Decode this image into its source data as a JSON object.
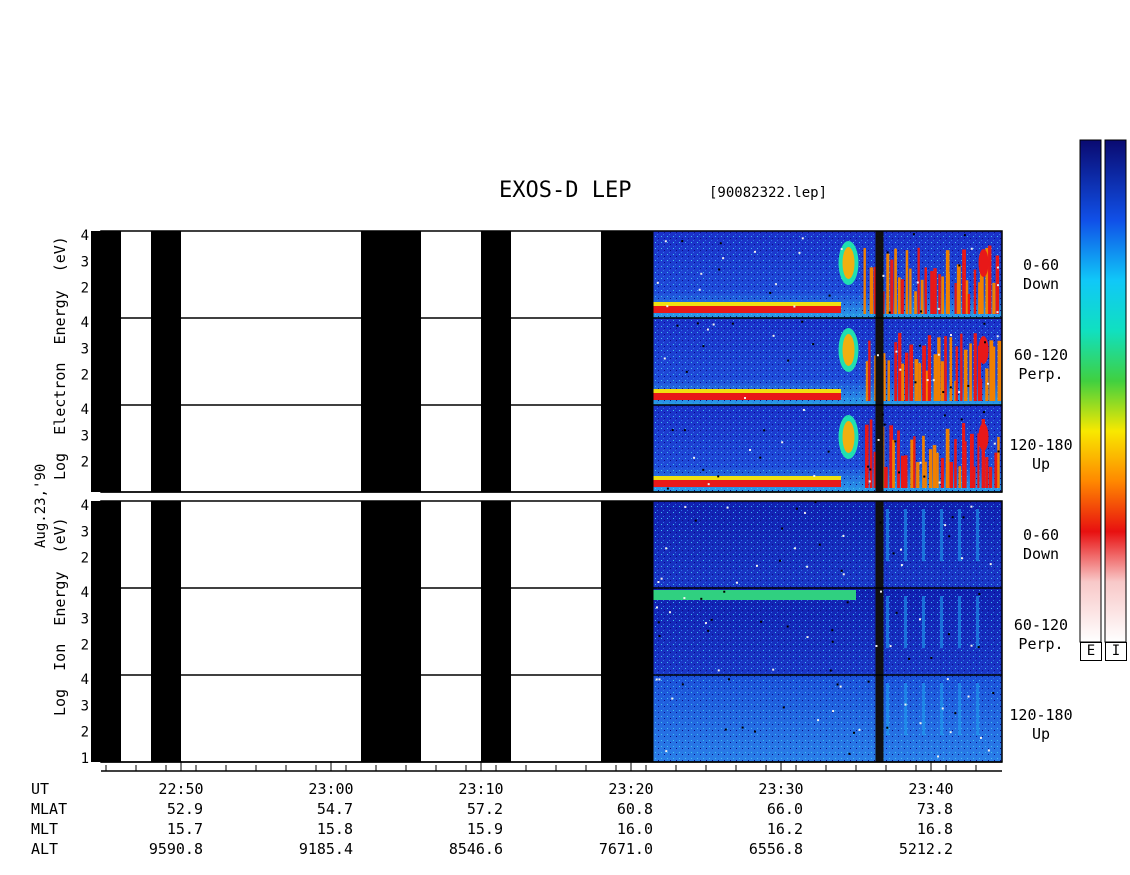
{
  "title": "EXOS-D LEP",
  "file_label": "[90082322.lep]",
  "date_label": "Aug.23,'90",
  "electron_ylabel": [
    "Log",
    "Electron",
    "Energy",
    "(eV)"
  ],
  "ion_ylabel": [
    "Log",
    "Ion",
    "Energy",
    "(eV)"
  ],
  "channels": [
    {
      "range": "0-60",
      "dir": "Down"
    },
    {
      "range": "60-120",
      "dir": "Perp."
    },
    {
      "range": "120-180",
      "dir": "Up"
    }
  ],
  "colorbar_labels": [
    "E",
    "I"
  ],
  "chart_data": {
    "type": "heatmap",
    "title": "EXOS-D LEP",
    "panels": [
      "Electron 0-60 Down",
      "Electron 60-120 Perp.",
      "Electron 120-180 Up",
      "Ion 0-60 Down",
      "Ion 60-120 Perp.",
      "Ion 120-180 Up"
    ],
    "y_ticks": [
      "4",
      "3",
      "2"
    ],
    "y_ticks_bottom": [
      "4",
      "3",
      "2",
      "1"
    ],
    "xlim_ut": [
      "22:44",
      "23:45"
    ],
    "x_ticks": [
      "22:50",
      "23:00",
      "23:10",
      "23:20",
      "23:30",
      "23:40"
    ],
    "no_data_intervals": [
      [
        "22:44",
        "22:46"
      ],
      [
        "22:48",
        "22:50"
      ],
      [
        "23:02",
        "23:06"
      ],
      [
        "23:10",
        "23:12"
      ],
      [
        "23:18",
        "23:21.5"
      ]
    ],
    "data_start_ut": "23:21.5",
    "orbit_table": {
      "row_labels": [
        "UT",
        "MLAT",
        "MLT",
        "ALT"
      ],
      "MLAT": [
        "52.9",
        "54.7",
        "57.2",
        "60.8",
        "66.0",
        "73.8"
      ],
      "MLT": [
        "15.7",
        "15.8",
        "15.9",
        "16.0",
        "16.2",
        "16.8"
      ],
      "ALT": [
        "9590.8",
        "9185.4",
        "8546.6",
        "7671.0",
        "6556.8",
        "5212.2"
      ]
    },
    "colors": {
      "background": "#1a2bd6",
      "cold": "#0a10a0",
      "warm": "#19c8f0",
      "hot": "#e81818"
    }
  }
}
